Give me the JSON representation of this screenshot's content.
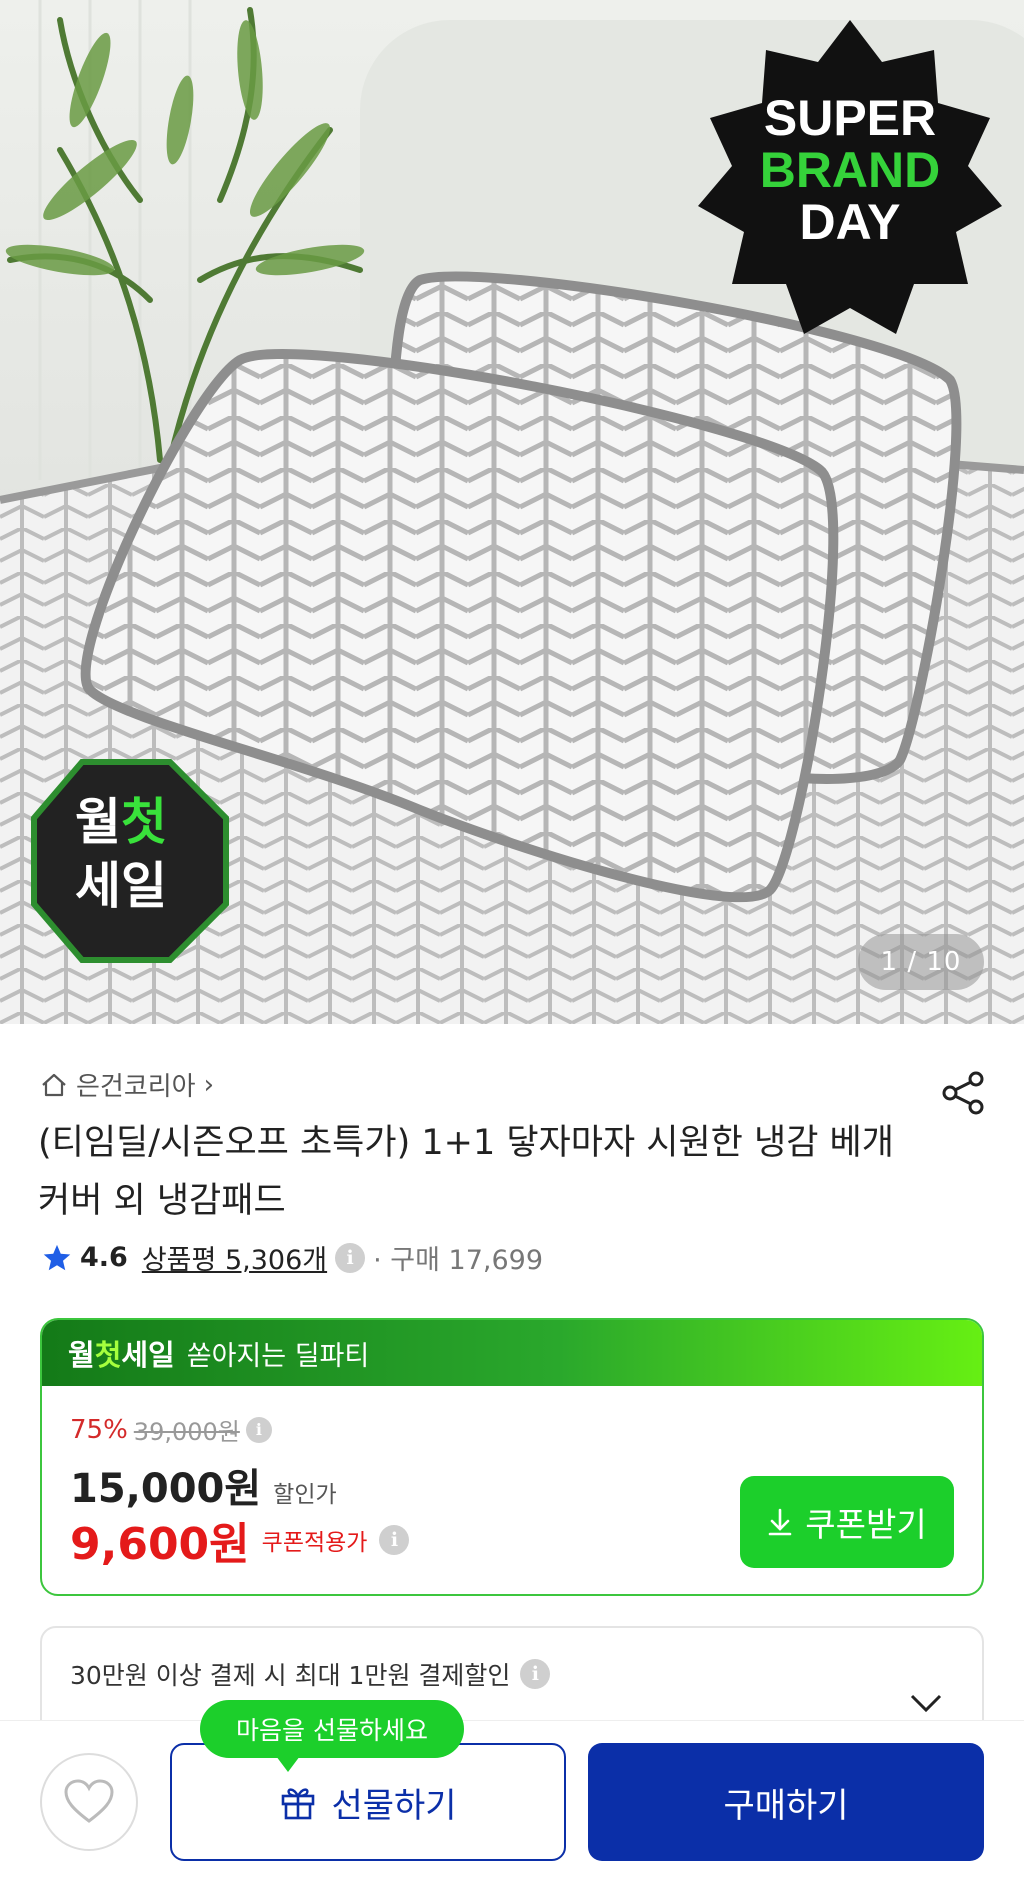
{
  "hero": {
    "badge_top": {
      "line1": "SUPER",
      "line2": "BRAND",
      "line3": "DAY"
    },
    "badge_bottom": {
      "line1_a": "월",
      "line1_b": "첫",
      "line2": "세일"
    },
    "counter": "1 / 10"
  },
  "product": {
    "brand": "은건코리아",
    "title": "(티임딜/시즌오프 초특가) 1+1 닿자마자 시원한 냉감 베개커버 외 냉감패드",
    "rating": "4.6",
    "reviews_label": "상품평 5,306개",
    "purchases": "· 구매 17,699"
  },
  "deal": {
    "logo_a": "월",
    "logo_b": "첫",
    "logo_c": "세일",
    "subtitle": "쏟아지는 딜파티",
    "discount_pct": "75%",
    "original_price": "39,000원",
    "sale_price": "15,000원",
    "sale_label": "할인가",
    "coupon_price": "9,600원",
    "coupon_label": "쿠폰적용가",
    "coupon_button": "쿠폰받기"
  },
  "payment": {
    "text": "30만원 이상 결제 시 최대 1만원 결제할인"
  },
  "bottom": {
    "tooltip": "마음을 선물하세요",
    "gift_button": "선물하기",
    "buy_button": "구매하기"
  },
  "colors": {
    "accent_green": "#1ccf2b",
    "brand_blue": "#0b2fa8",
    "sale_red": "#e41a1a"
  }
}
